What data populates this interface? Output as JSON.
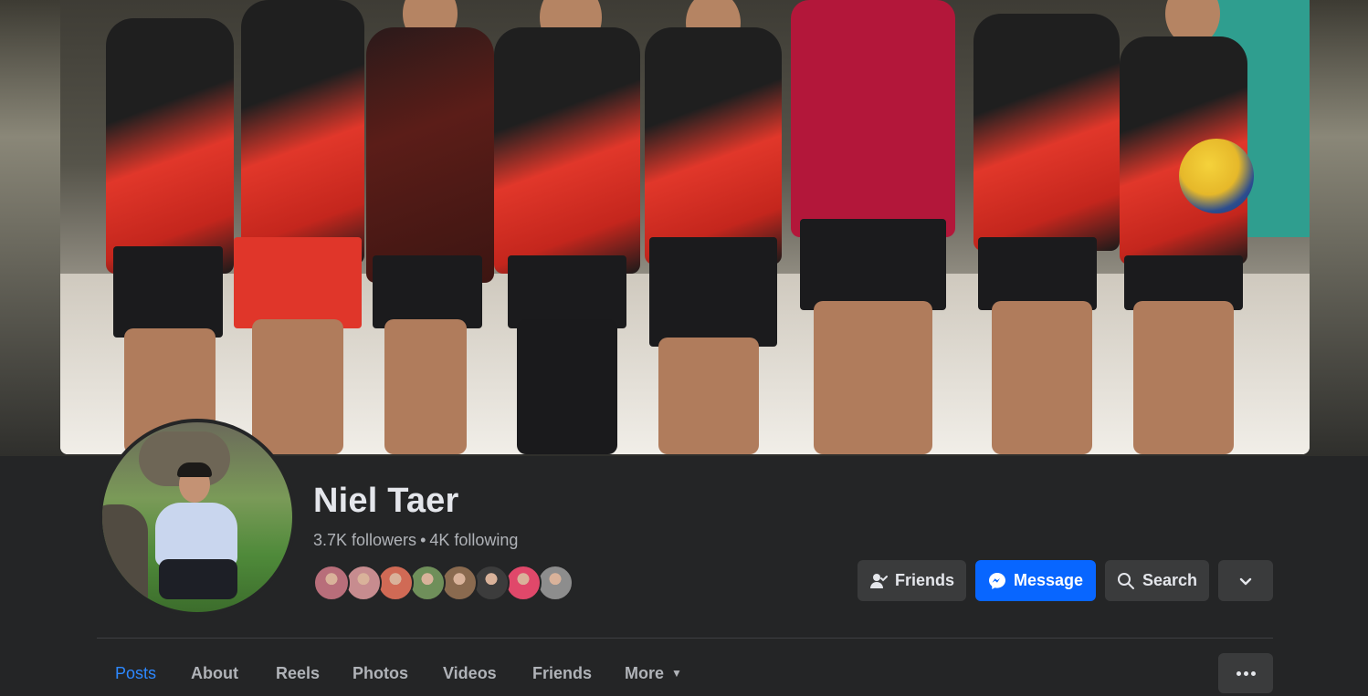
{
  "profile": {
    "name": "Niel Taer",
    "followers": "3.7K followers",
    "separator": "•",
    "following": "4K following"
  },
  "mutual_friends": [
    {
      "color": "#b86e7a"
    },
    {
      "color": "#c78c8f"
    },
    {
      "color": "#d06a55"
    },
    {
      "color": "#6f8f5a"
    },
    {
      "color": "#8a6a4f"
    },
    {
      "color": "#3c3c3c"
    },
    {
      "color": "#e0486a"
    },
    {
      "color": "#8d8d8d"
    }
  ],
  "actions": {
    "friends_label": "Friends",
    "message_label": "Message",
    "search_label": "Search"
  },
  "tabs": [
    {
      "label": "Posts",
      "active": true
    },
    {
      "label": "About"
    },
    {
      "label": "Reels"
    },
    {
      "label": "Photos"
    },
    {
      "label": "Videos"
    },
    {
      "label": "Friends"
    },
    {
      "label": "More"
    }
  ],
  "colors": {
    "accent": "#0866ff",
    "active_tab": "#2d88ff",
    "background": "#242526"
  }
}
